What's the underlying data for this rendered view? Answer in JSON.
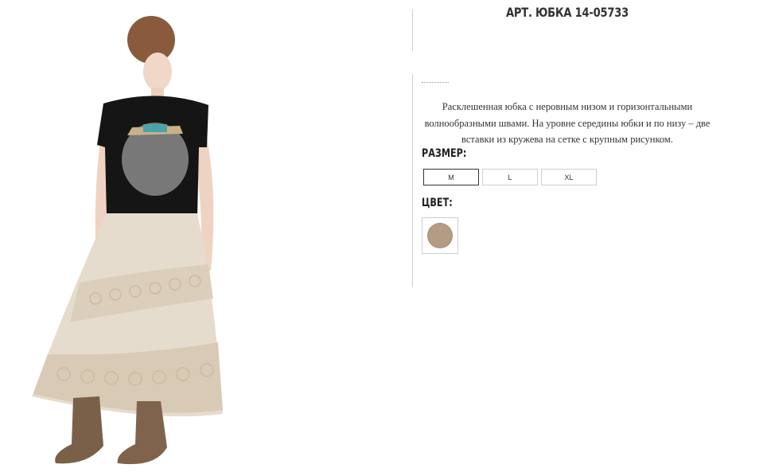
{
  "product": {
    "title_prefix": "АРТ.",
    "title_code": "ЮБКА 14-05733",
    "description": "Расклешенная юбка с неровным низом и горизонтальными волнообразными швами. На уровне середины юбки и по низу – две вставки из кружева на сетке с крупным рисунком.",
    "image_icon": "model-photo"
  },
  "size": {
    "label": "РАЗМЕР:",
    "options": [
      "M",
      "L",
      "XL"
    ],
    "selected": "M"
  },
  "color": {
    "label": "ЦВЕТ:",
    "swatch_hex": "#b39b84"
  },
  "colors": {
    "divider": "#d0d0d0",
    "text": "#333333"
  }
}
